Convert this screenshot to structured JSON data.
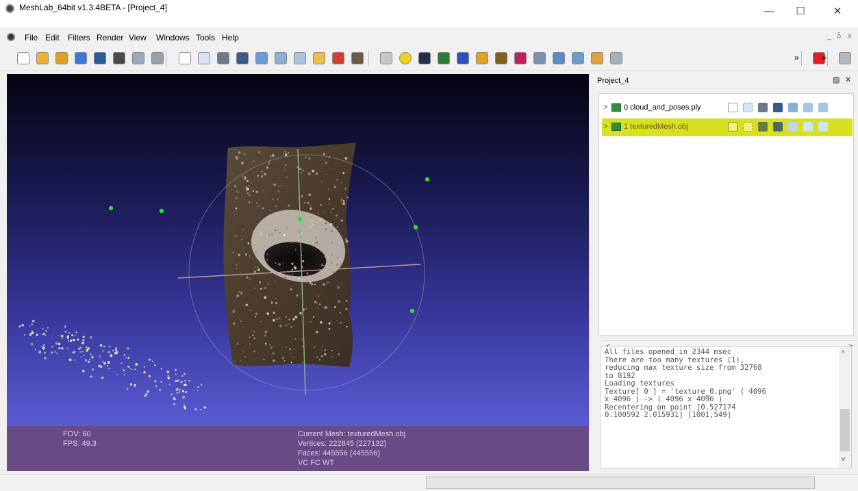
{
  "window": {
    "title": "MeshLab_64bit v1.3.4BETA - [Project_4]",
    "minimize_glyph": "—",
    "maximize_glyph": "☐",
    "close_glyph": "✕"
  },
  "menu": {
    "items": [
      "File",
      "Edit",
      "Filters",
      "Render",
      "View",
      "Windows",
      "Tools",
      "Help"
    ],
    "mdi_controls": [
      "_",
      "ȱ",
      "x"
    ]
  },
  "toolbar": {
    "more_glyph": "»",
    "icons": [
      "new-project-icon",
      "open-project-icon",
      "import-mesh-icon",
      "reload-icon",
      "export-mesh-icon",
      "snapshot-icon",
      "render-layer-icon",
      "lock-icon",
      "bounding-box-icon",
      "points-icon",
      "wireframe-icon",
      "hidden-lines-icon",
      "flat-shading-icon",
      "smooth-shading-icon",
      "texture-icon",
      "light-icon",
      "color-per-vertex-icon",
      "color-per-face-icon",
      "trackball-icon",
      "align-icon",
      "quality-mapper-icon",
      "sphere-icon",
      "axes-icon",
      "paint-icon",
      "brush-icon",
      "pick-points-icon",
      "measure-icon",
      "select-vertices-icon",
      "select-faces-icon",
      "select-connected-icon",
      "select-area-icon",
      "delete-icon",
      "search-icon"
    ]
  },
  "viewport": {
    "info": {
      "fov": "FOV: 60",
      "fps": "FPS:  49.3",
      "current_mesh": "Current Mesh: texturedMesh.obj",
      "vertices": "Vertices: 222845 (227132)",
      "faces": "Faces: 445556 (445556)",
      "flags": "VC FC WT"
    }
  },
  "project_panel": {
    "title": "Project_4",
    "float_glyph": "▨",
    "close_glyph": "✕",
    "layers": [
      {
        "label": "0 cloud_and_poses.ply",
        "selected": false
      },
      {
        "label": "1 texturedMesh.obj",
        "selected": true
      }
    ],
    "scroll_left": "<",
    "scroll_right": ">"
  },
  "log": {
    "lines": [
      "All files opened in 2344 msec",
      "There are too many textures (1),",
      "reducing max texture size from 32768",
      "to 8192",
      "Loading textures",
      "Texture[ 0 ] = 'texture_0.png' ( 4096",
      "x 4096 ) -> ( 4096 x 4096 )",
      "Recentering on point [0.527174",
      "0.100592 2.015931] [1001,549]"
    ],
    "scroll_up": "^",
    "scroll_down": "v"
  },
  "colors": {
    "selected_layer": "#d9e021",
    "info_bar": "#6a4a86",
    "camera_point": "#29e02c"
  }
}
